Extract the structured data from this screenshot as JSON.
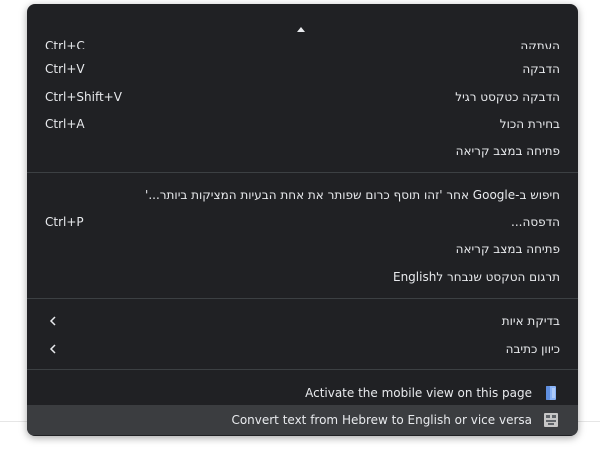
{
  "menu": {
    "partial_item": {
      "label": "העתקה",
      "shortcut": "Ctrl+C"
    },
    "items": [
      {
        "label": "הדבקה",
        "shortcut": "Ctrl+V"
      },
      {
        "label": "הדבקה כטקסט רגיל",
        "shortcut": "Ctrl+Shift+V"
      },
      {
        "label": "בחירת הכול",
        "shortcut": "Ctrl+A"
      },
      {
        "label": "פתיחה במצב קריאה",
        "shortcut": ""
      },
      {
        "label": "חיפוש ב-Google אחר 'זהו תוסף כרום שפותר את אחת הבעיות המציקות ביותר...'",
        "shortcut": ""
      },
      {
        "label": "הדפסה...",
        "shortcut": "Ctrl+P"
      },
      {
        "label": "פתיחה במצב קריאה",
        "shortcut": ""
      },
      {
        "label": "תרגום הטקסט שנבחר לEnglish",
        "shortcut": ""
      },
      {
        "label": "בדיקת איות",
        "shortcut": "",
        "submenu": true
      },
      {
        "label": "כיוון כתיבה",
        "shortcut": "",
        "submenu": true
      }
    ],
    "extensions": [
      {
        "label": "Activate the mobile view on this page",
        "icon": "mobile-view-icon",
        "icon_color": "#8ab4f8"
      },
      {
        "label": "Convert text from Hebrew to English or vice versa",
        "icon": "keyboard-convert-icon",
        "icon_color": "#c7c7c7"
      }
    ],
    "colors": {
      "background": "#202124",
      "text": "#e8eaed",
      "separator": "#3c4043",
      "highlight": "#3b3d40"
    }
  }
}
